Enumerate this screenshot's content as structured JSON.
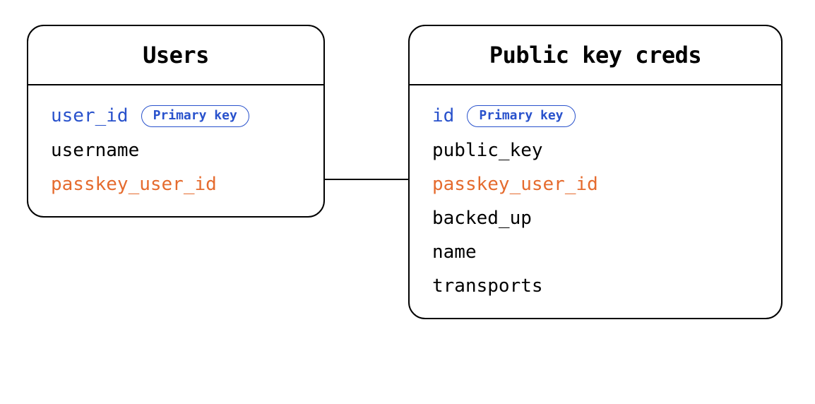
{
  "entities": {
    "users": {
      "title": "Users",
      "fields": [
        {
          "name": "user_id",
          "kind": "primary",
          "badge": "Primary key"
        },
        {
          "name": "username",
          "kind": "normal"
        },
        {
          "name": "passkey_user_id",
          "kind": "foreign"
        }
      ]
    },
    "creds": {
      "title": "Public key creds",
      "fields": [
        {
          "name": "id",
          "kind": "primary",
          "badge": "Primary key"
        },
        {
          "name": "public_key",
          "kind": "normal"
        },
        {
          "name": "passkey_user_id",
          "kind": "foreign"
        },
        {
          "name": "backed_up",
          "kind": "normal"
        },
        {
          "name": "name",
          "kind": "normal"
        },
        {
          "name": "transports",
          "kind": "normal"
        }
      ]
    }
  },
  "relation": {
    "from": "users.passkey_user_id",
    "to": "creds.passkey_user_id"
  }
}
